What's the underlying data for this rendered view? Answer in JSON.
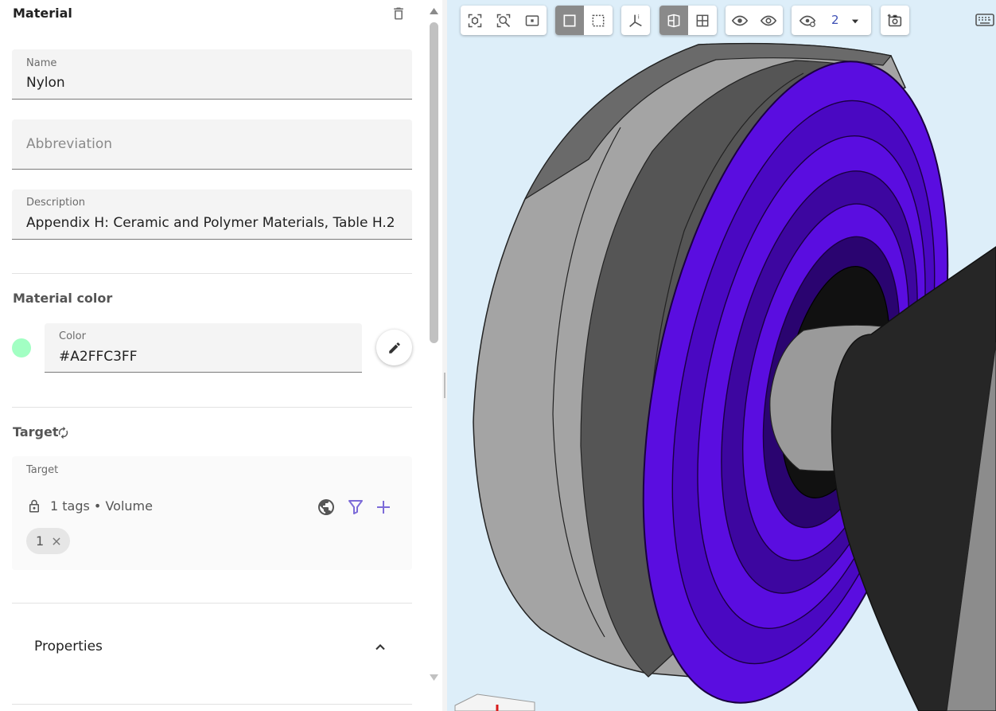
{
  "panel": {
    "title": "Material",
    "name_field": {
      "label": "Name",
      "value": "Nylon"
    },
    "abbreviation_field": {
      "placeholder": "Abbreviation",
      "value": ""
    },
    "description_field": {
      "label": "Description",
      "value": "Appendix H: Ceramic and Polymer Materials, Table H.2"
    },
    "material_color": {
      "title": "Material color",
      "field_label": "Color",
      "value": "#A2FFC3FF",
      "swatch": "#A2FFC3"
    },
    "target": {
      "title": "Target",
      "box_label": "Target",
      "summary": "1 tags • Volume",
      "chips": [
        "1"
      ]
    },
    "properties": {
      "title": "Properties"
    }
  },
  "toolbar": {
    "view_count": "2"
  },
  "colors": {
    "accent_purple": "#7c6bd8",
    "viewer_bg": "#ddeef9",
    "part_violet": "#5a0de0",
    "part_gray": "#a4a4a4",
    "part_dark": "#262626"
  },
  "icons": [
    "delete-icon",
    "refresh-icon",
    "lock-icon",
    "globe-icon",
    "filter-icon",
    "plus-icon",
    "close-icon",
    "pencil-icon",
    "chevron-up-icon",
    "zoom-fit-icon",
    "zoom-area-icon",
    "zoom-screen-icon",
    "select-box-icon",
    "select-area-icon",
    "axes-icon",
    "view-section-icon",
    "view-grid-icon",
    "show-icon",
    "hide-icon",
    "visibility-icon",
    "dropdown-icon",
    "screenshot-icon",
    "keyboard-icon"
  ]
}
